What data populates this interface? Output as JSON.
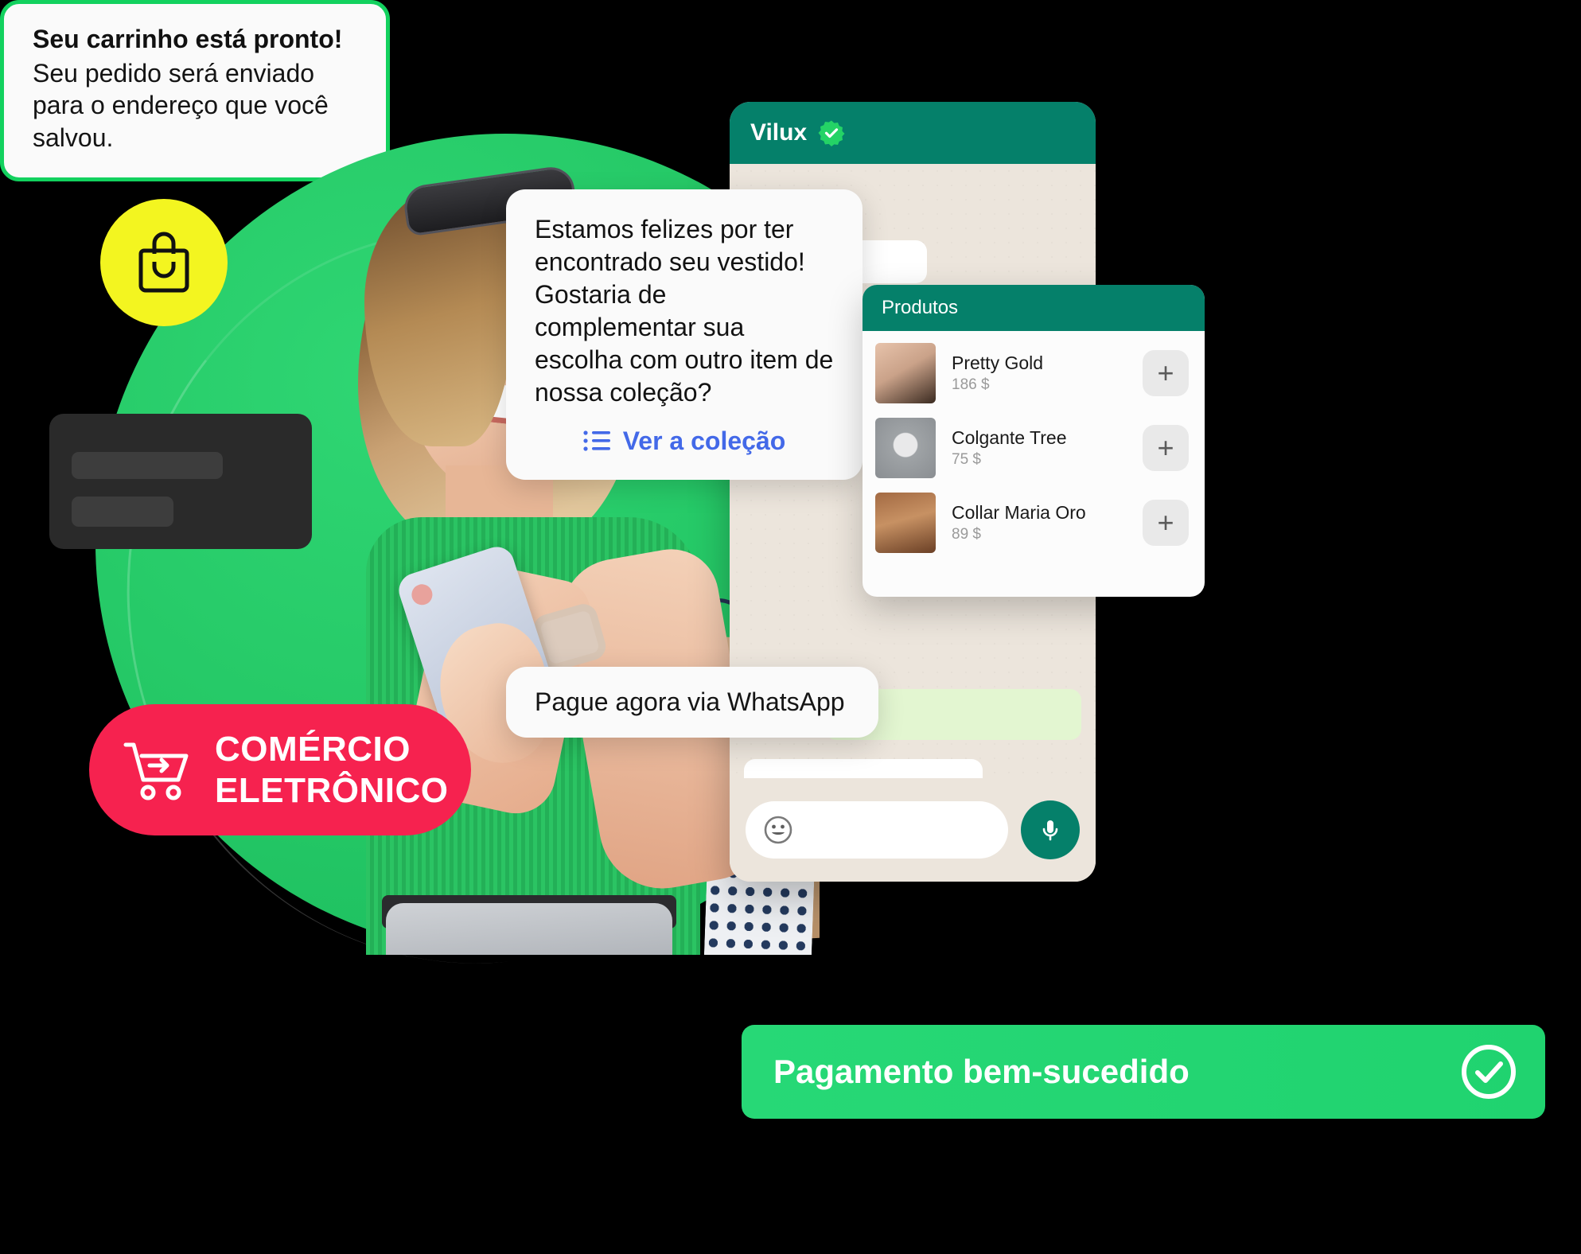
{
  "badges": {
    "bag_icon": "shopping-bag-icon",
    "ecommerce": {
      "icon": "shopping-cart-arrow-icon",
      "line1": "COMÉRCIO",
      "line2": "ELETRÔNICO"
    }
  },
  "chat": {
    "header": {
      "name": "Vilux",
      "verified_icon": "verified-badge-icon"
    },
    "input": {
      "emoji_icon": "emoji-smiley-icon",
      "placeholder": "",
      "value": "",
      "mic_icon": "microphone-icon"
    }
  },
  "bubbles": {
    "collection": {
      "text": "Estamos felizes por ter encontrado seu vestido! Gostaria de complementar sua escolha com outro item de nossa coleção?",
      "link_icon": "list-icon",
      "link_label": "Ver a coleção",
      "link_color": "#4369e8"
    },
    "cart": {
      "title": "Seu carrinho está pronto!",
      "text": "Seu pedido será enviado para o endereço que você salvou.",
      "border_color": "#12d15e"
    },
    "pay": {
      "text": "Pague agora via WhatsApp"
    }
  },
  "products_card": {
    "title": "Produtos",
    "add_label": "+",
    "items": [
      {
        "name": "Pretty Gold",
        "price": "186 $",
        "thumb": "necklace-gold-photo"
      },
      {
        "name": "Colgante Tree",
        "price": "75 $",
        "thumb": "tree-pendant-photo"
      },
      {
        "name": "Collar Maria Oro",
        "price": "89 $",
        "thumb": "maria-pendant-photo"
      }
    ]
  },
  "payment_banner": {
    "text": "Pagamento bem-sucedido",
    "icon": "check-circle-icon",
    "color": "#27d876"
  },
  "colors": {
    "brand_green": "#24c765",
    "whatsapp_teal": "#05806a",
    "pink": "#f6224f",
    "yellow": "#f3f520",
    "link_blue": "#4369e8"
  }
}
